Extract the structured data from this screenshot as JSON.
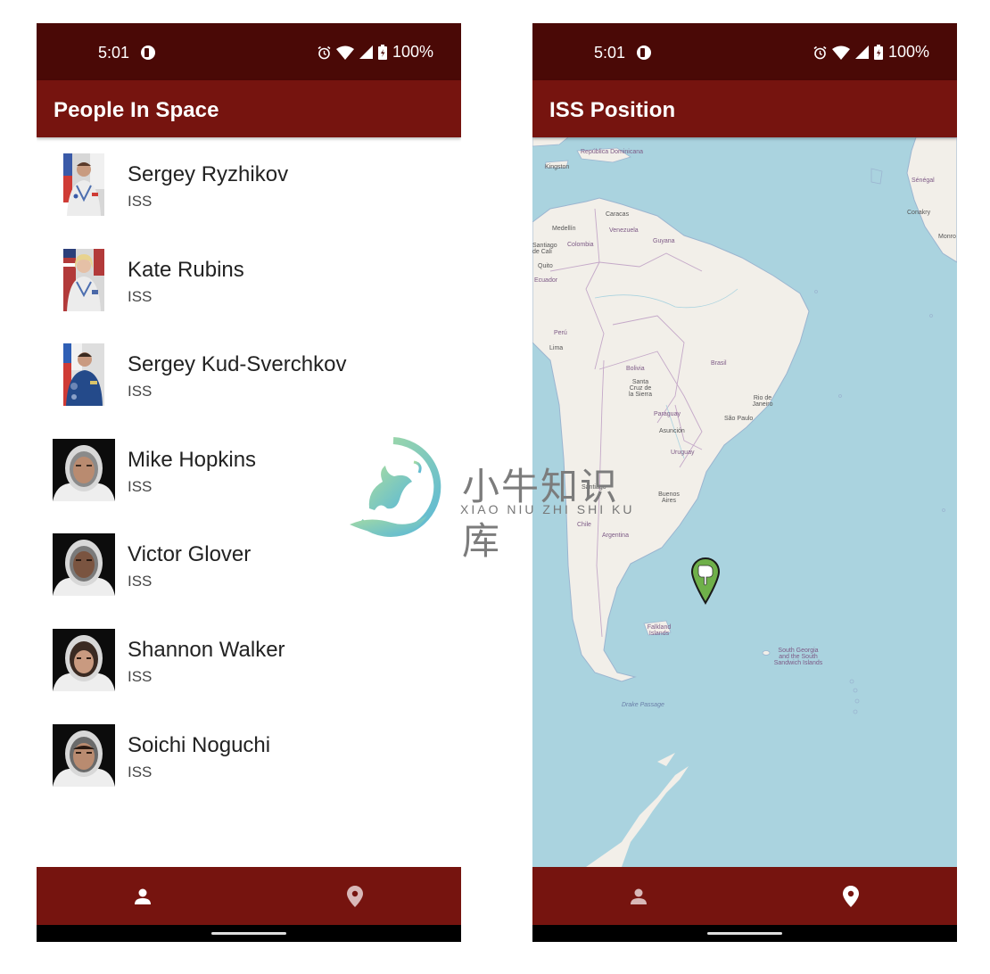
{
  "status_bar": {
    "time": "5:01",
    "battery_text": "100%",
    "icons": [
      "app-notification-icon",
      "alarm-icon",
      "wifi-icon",
      "signal-icon",
      "battery-charging-icon"
    ]
  },
  "people_screen": {
    "title": "People In Space",
    "people": [
      {
        "name": "Sergey Ryzhikov",
        "craft": "ISS",
        "photo": "portrait-flag-ru"
      },
      {
        "name": "Kate Rubins",
        "craft": "ISS",
        "photo": "portrait-flag-us"
      },
      {
        "name": "Sergey Kud-Sverchkov",
        "craft": "ISS",
        "photo": "portrait-flag-ru"
      },
      {
        "name": "Mike Hopkins",
        "craft": "ISS",
        "photo": "portrait-helmet"
      },
      {
        "name": "Victor Glover",
        "craft": "ISS",
        "photo": "portrait-helmet"
      },
      {
        "name": "Shannon Walker",
        "craft": "ISS",
        "photo": "portrait-helmet"
      },
      {
        "name": "Soichi Noguchi",
        "craft": "ISS",
        "photo": "portrait-helmet"
      }
    ],
    "bottom_nav": {
      "active": "people",
      "items": [
        {
          "id": "people",
          "icon": "person-icon"
        },
        {
          "id": "iss-position",
          "icon": "location-pin-icon"
        }
      ]
    }
  },
  "iss_screen": {
    "title": "ISS Position",
    "map_labels": {
      "republica_dominicana": "República Dominicana",
      "kingston": "Kingston",
      "caracas": "Caracas",
      "medellin": "Medellín",
      "venezuela": "Venezuela",
      "guyana": "Guyana",
      "santiago_de_cali": "Santiago de Cali",
      "colombia": "Colombia",
      "quito": "Quito",
      "ecuador": "Ecuador",
      "peru": "Perú",
      "lima": "Lima",
      "bolivia": "Bolivia",
      "santa_cruz": "Santa Cruz de la Sierra",
      "brasil": "Brasil",
      "rio": "Rio de Janeiro",
      "sao_paulo": "São Paulo",
      "paraguay": "Paraguay",
      "asuncion": "Asunción",
      "uruguay": "Uruguay",
      "santiago": "Santiago",
      "buenos_aires": "Buenos Aires",
      "chile": "Chile",
      "argentina": "Argentina",
      "falkland": "Falkland Islands",
      "south_georgia": "South Georgia and the South Sandwich Islands",
      "drake": "Drake Passage",
      "senegal": "Sénégal",
      "conakry": "Conakry",
      "monrovia": "Monro"
    },
    "marker_icon": "pointing-hand-marker-icon",
    "bottom_nav": {
      "active": "iss-position",
      "items": [
        {
          "id": "people",
          "icon": "person-icon"
        },
        {
          "id": "iss-position",
          "icon": "location-pin-icon"
        }
      ]
    }
  },
  "watermark": {
    "chinese": "小牛知识库",
    "pinyin": "XIAO NIU ZHI SHI KU"
  },
  "colors": {
    "status_bar": "#4a0906",
    "app_bar": "#76140f",
    "nav_active": "#ffffff",
    "nav_inactive": "#d9b8b8",
    "ocean": "#aad3df",
    "land": "#f2efe9",
    "marker": "#6fb04a"
  }
}
